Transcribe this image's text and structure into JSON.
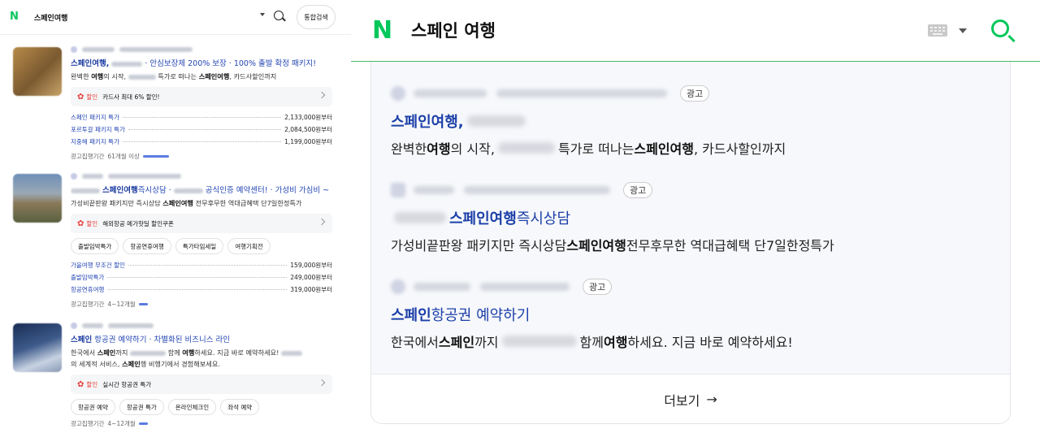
{
  "left": {
    "query": "스페인여행",
    "search_button": "통합검색",
    "ads": [
      {
        "title_pre": "스페인여행,",
        "title_post": " · 안심보장제 200% 보장 · 100% 출발 확정 패키지!",
        "desc_1": "완벽한 ",
        "desc_b1": "여행",
        "desc_2": "의 시작, ",
        "desc_3": " 특가로 떠나는 ",
        "desc_b2": "스페인여행",
        "desc_4": ", 카드사할인까지",
        "promo_tag": "할인",
        "promo_text": "카드사 최대 6% 할인!",
        "rows": [
          {
            "name": "스페인 패키지 특가",
            "price": "2,133,000원부터"
          },
          {
            "name": "포르투갈 패키지 특가",
            "price": "2,084,500원부터"
          },
          {
            "name": "지중해 패키지 특가",
            "price": "1,199,000원부터"
          }
        ],
        "period_label": "광고집행기간",
        "period_value": "61개월 이상",
        "period_fill": 0.9
      },
      {
        "title_b": "스페인여행",
        "title_post": "즉시상담 · ",
        "title_post2": " 공식인증 예약센터! · 가성비 가심비 ~",
        "desc_1": "가성비끝판왕 패키지만 즉시상담 ",
        "desc_b1": "스페인여행",
        "desc_2": " 전무후무한 역대급혜택 단7일한정특가",
        "promo_tag": "할인",
        "promo_text": "해외항공 메가핫딜 할인쿠폰",
        "chips": [
          "출발임박특가",
          "항공연휴여행",
          "특가타임세일",
          "여행기획전"
        ],
        "rows": [
          {
            "name": "가을여행 무조건 할인",
            "price": "159,000원부터"
          },
          {
            "name": "출발임박특가",
            "price": "249,000원부터"
          },
          {
            "name": "항공연휴여행",
            "price": "319,000원부터"
          }
        ],
        "period_label": "광고집행기간",
        "period_value": "4~12개월",
        "period_fill": 0.3
      },
      {
        "title_b": "스페인",
        "title_post": " 항공권 예약하기 · 차별화된 비즈니스 라인",
        "desc_1": "한국에서 ",
        "desc_b1": "스페인",
        "desc_2": "까지 ",
        "desc_3": " 함께 ",
        "desc_b2": "여행",
        "desc_4": "하세요. 지금 바로 예약하세요! ",
        "desc_line2_1": "의 세계적 서비스, ",
        "desc_line2_b": "스페인",
        "desc_line2_2": "행 비행기에서 경험해보세요.",
        "promo_tag": "할인",
        "promo_text": "실시간 항공권 특가",
        "chips": [
          "항공권 예약",
          "항공권 특가",
          "온라인체크인",
          "좌석 예약"
        ],
        "period_label": "광고집행기간",
        "period_value": "4~12개월",
        "period_fill": 0.3
      }
    ]
  },
  "right": {
    "query": "스페인 여행",
    "ad_label": "광고",
    "ads": [
      {
        "title": "스페인여행,",
        "desc_1": "완벽한 ",
        "desc_b1": "여행",
        "desc_2": "의 시작, ",
        "desc_3": "특가로 떠나는 ",
        "desc_b2": "스페인여행",
        "desc_4": ", 카드사할인까지"
      },
      {
        "title_b": "스페인여행",
        "title_post": "즉시상담",
        "desc_1": "가성비끝판왕 패키지만 즉시상담 ",
        "desc_b1": "스페인여행",
        "desc_2": " 전무후무한 역대급혜택 단7일한정특가"
      },
      {
        "title_b": "스페인",
        "title_post": " 항공권 예약하기",
        "desc_1": "한국에서 ",
        "desc_b1": "스페인",
        "desc_2": "까지 ",
        "desc_3": "함께 ",
        "desc_b2": "여행",
        "desc_4": "하세요. 지금 바로 예약하세요!"
      }
    ],
    "more_label": "더보기",
    "more_arrow": "→"
  },
  "logo_letter": "N",
  "colors": {
    "brand": "#03c75a",
    "link": "#2346b3",
    "promo": "#e83a3a"
  }
}
